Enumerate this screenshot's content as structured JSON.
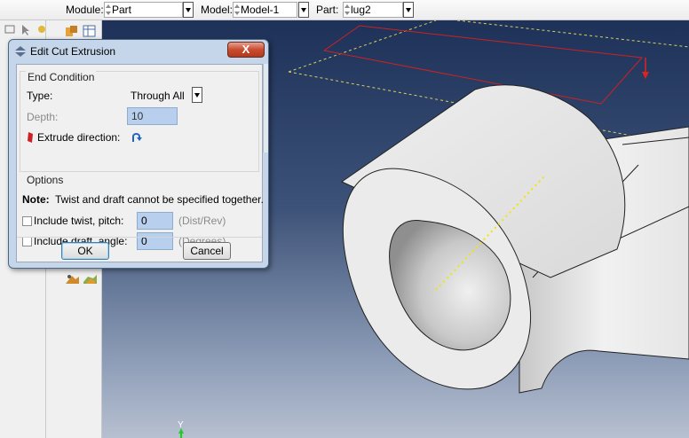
{
  "context_bar": {
    "module_label": "Module:",
    "module_value": "Part",
    "model_label": "Model:",
    "model_value": "Model-1",
    "part_label": "Part:",
    "part_value": "lug2"
  },
  "dialog": {
    "title": "Edit Cut Extrusion",
    "close_label": "X",
    "end_condition": {
      "group_title": "End Condition",
      "type_label": "Type:",
      "type_value": "Through All",
      "depth_label": "Depth:",
      "depth_value": "10",
      "extrude_direction_label": "Extrude direction:"
    },
    "options": {
      "group_title": "Options",
      "note_prefix": "Note:",
      "note_text": "Twist and draft cannot be specified together.",
      "twist_label": "Include twist, pitch:",
      "twist_value": "0",
      "twist_unit": "(Dist/Rev)",
      "twist_checked": false,
      "draft_label": "Include draft, angle:",
      "draft_value": "0",
      "draft_unit": "(Degrees)",
      "draft_checked": false
    },
    "ok_label": "OK",
    "cancel_label": "Cancel"
  },
  "viewport": {
    "axis_label": "Y"
  },
  "colors": {
    "accent_red": "#cc2222",
    "centerline_yellow": "#f2e600",
    "dialog_frame": "#c6d6ea",
    "field_fill": "#b8d0ed"
  }
}
